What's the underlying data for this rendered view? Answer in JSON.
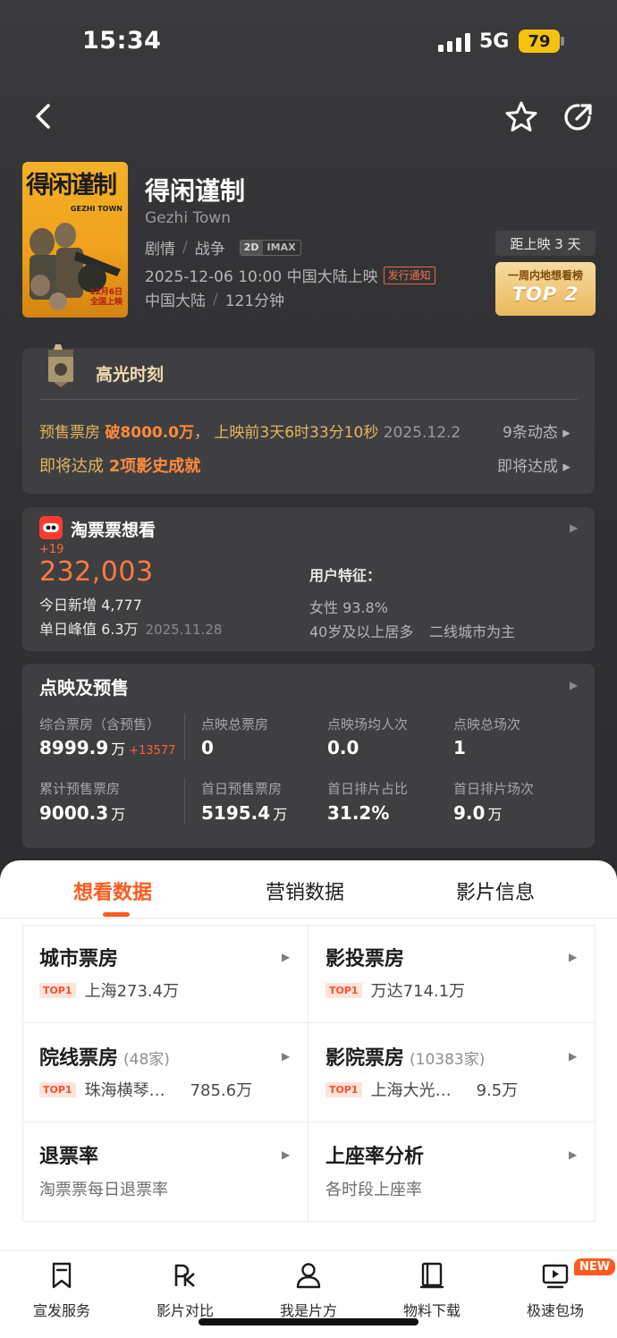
{
  "status_bar": {
    "time": "15:34",
    "network": "5G",
    "battery": "79"
  },
  "movie": {
    "poster_title": "得闲谨制",
    "poster_sub": "GEZHI TOWN",
    "poster_date": "12月6日\n全国上映",
    "title_cn": "得闲谨制",
    "title_en": "Gezhi Town",
    "genre1": "剧情",
    "genre2": "战争",
    "format_a": "2D",
    "format_b": "IMAX",
    "release": "2025-12-06 10:00 中国大陆上映",
    "notice": "发行通知",
    "region": "中国大陆",
    "duration": "121分钟",
    "days_left": "距上映 3 天",
    "rank_label": "一周内地想看榜",
    "rank_value": "TOP 2"
  },
  "highlight": {
    "title": "高光时刻",
    "row1_a": "预售票房 ",
    "row1_b": "破8000.0万",
    "row1_c": "， 上映前3天6时33分10秒 ",
    "row1_date": "2025.12.2",
    "dynamics": "9条动态 ▸",
    "row2_a": "即将达成 ",
    "row2_b": "2项影史成就",
    "soon": "即将达成 ▸"
  },
  "want": {
    "title": "淘票票想看",
    "plus": "+19",
    "total": "232,003",
    "today_label": "今日新增 4,777",
    "peak_label": "单日峰值 6.3万",
    "peak_date": "2025.11.28",
    "feature_title": "用户特征：",
    "gender": "女性 93.8%",
    "age": "40岁及以上居多",
    "city": "二线城市为主"
  },
  "presale": {
    "title": "点映及预售",
    "c1_label": "综合票房（含预售）",
    "c1_value": "8999.9",
    "c1_unit": "万",
    "c1_inc": "+13577",
    "c2_label": "点映总票房",
    "c2_value": "0",
    "c3_label": "点映场均人次",
    "c3_value": "0.0",
    "c4_label": "点映总场次",
    "c4_value": "1",
    "d1_label": "累计预售票房",
    "d1_value": "9000.3",
    "d1_unit": "万",
    "d2_label": "首日预售票房",
    "d2_value": "5195.4",
    "d2_unit": "万",
    "d3_label": "首日排片占比",
    "d3_value": "31.2%",
    "d4_label": "首日排片场次",
    "d4_value": "9.0",
    "d4_unit": "万"
  },
  "tabs": [
    "想看数据",
    "营销数据",
    "影片信息"
  ],
  "cells": {
    "city_box": {
      "title": "城市票房",
      "tag": "TOP1",
      "text": "上海273.4万"
    },
    "invest_box": {
      "title": "影投票房",
      "tag": "TOP1",
      "text": "万达714.1万"
    },
    "chain_box": {
      "title": "院线票房",
      "count": "(48家)",
      "tag": "TOP1",
      "name": "珠海横琴…",
      "value": "785.6万"
    },
    "cinema_box": {
      "title": "影院票房",
      "count": "(10383家)",
      "tag": "TOP1",
      "name": "上海大光…",
      "value": "9.5万"
    },
    "refund": {
      "title": "退票率",
      "sub": "淘票票每日退票率"
    },
    "occupancy": {
      "title": "上座率分析",
      "sub": "各时段上座率"
    }
  },
  "bottom_nav": [
    {
      "label": "宣发服务",
      "icon": "bookmark-icon"
    },
    {
      "label": "影片对比",
      "icon": "pk-icon"
    },
    {
      "label": "我是片方",
      "icon": "person-icon"
    },
    {
      "label": "物料下载",
      "icon": "book-icon"
    },
    {
      "label": "极速包场",
      "icon": "play-screen-icon"
    }
  ],
  "new_badge": "NEW",
  "colors": {
    "accent": "#ff5a1f",
    "gold": "#e3b560",
    "dark_bg": "#2b2b2d"
  }
}
